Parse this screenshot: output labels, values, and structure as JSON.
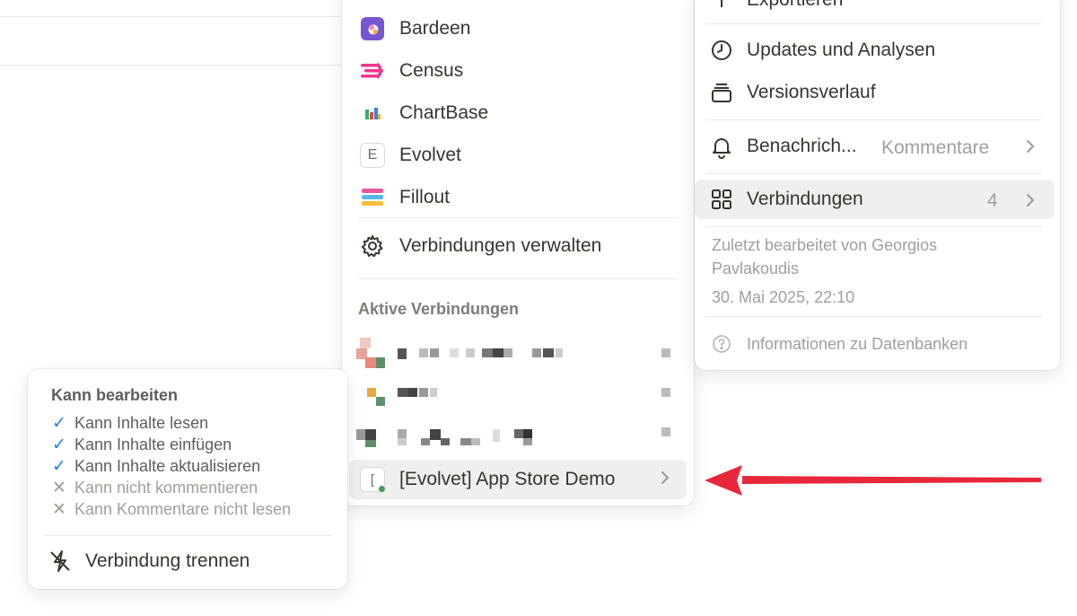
{
  "connections_menu": {
    "integrations": [
      {
        "label": "Bardeen",
        "icon": "bardeen-logo-icon"
      },
      {
        "label": "Census",
        "icon": "census-logo-icon"
      },
      {
        "label": "ChartBase",
        "icon": "chartbase-logo-icon"
      },
      {
        "label": "Evolvet",
        "icon": "evolvet-logo-icon",
        "letter": "E"
      },
      {
        "label": "Fillout",
        "icon": "fillout-logo-icon"
      }
    ],
    "manage_label": "Verbindungen verwalten",
    "active_heading": "Aktive Verbindungen",
    "active_connection_label": "[Evolvet] App Store Demo",
    "active_connection_letter": "["
  },
  "settings_menu": {
    "partial_top_label": "Exportieren",
    "updates_label": "Updates und Analysen",
    "history_label": "Versionsverlauf",
    "notifications_label": "Benachrich...",
    "notifications_value": "Kommentare",
    "connections_label": "Verbindungen",
    "connections_count": "4",
    "last_edited_line1": "Zuletzt bearbeitet von Georgios",
    "last_edited_line2": "Pavlakoudis",
    "last_edited_date": "30. Mai 2025, 22:10",
    "db_info_label": "Informationen zu Datenbanken"
  },
  "permissions_popup": {
    "title": "Kann bearbeiten",
    "items": [
      {
        "label": "Kann Inhalte lesen",
        "allowed": true
      },
      {
        "label": "Kann Inhalte einfügen",
        "allowed": true
      },
      {
        "label": "Kann Inhalte aktualisieren",
        "allowed": true
      },
      {
        "label": "Kann nicht kommentieren",
        "allowed": false
      },
      {
        "label": "Kann Kommentare nicht lesen",
        "allowed": false
      }
    ],
    "check_glyph": "✓",
    "cross_glyph": "✕",
    "disconnect_label": "Verbindung trennen"
  },
  "colors": {
    "accent_blue": "#2383e2",
    "arrow_red": "#e8283a",
    "status_green": "#4a9b5f",
    "highlight_bg": "#efefed"
  }
}
